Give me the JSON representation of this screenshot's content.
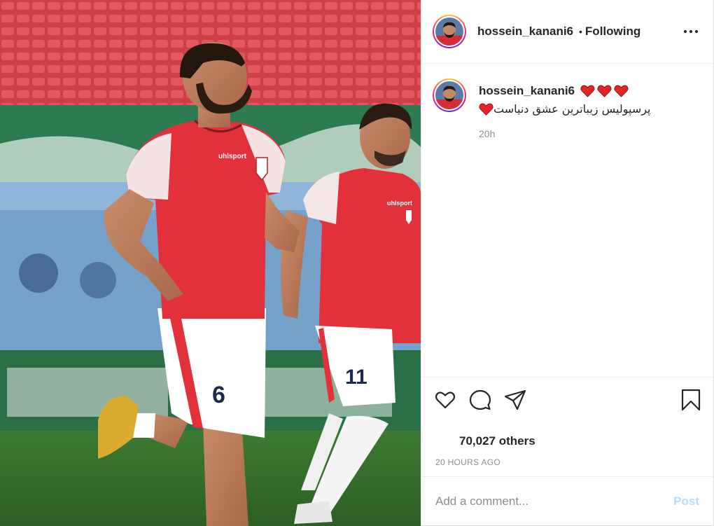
{
  "post": {
    "image": {
      "kit_brand": "uhlsport",
      "players": [
        {
          "shirt_number": "6"
        },
        {
          "shirt_number": "11"
        }
      ]
    },
    "header": {
      "username": "hossein_kanani6",
      "separator": "•",
      "follow_status": "Following"
    },
    "caption": {
      "username": "hossein_kanani6",
      "text": "پرسپولیس زیباترین عشق دنیاست",
      "emoji": "heart",
      "time": "20h"
    },
    "actions": {
      "like_icon": "heart-icon",
      "comment_icon": "comment-icon",
      "share_icon": "paper-plane-icon",
      "save_icon": "bookmark-icon"
    },
    "likes_text": "70,027 others",
    "post_time": "20 HOURS AGO",
    "comment": {
      "placeholder": "Add a comment...",
      "post_label": "Post"
    }
  },
  "colors": {
    "accent_blue_disabled": "#b2dffc",
    "muted_text": "#8e8e8e",
    "heart_red": "#ed4956",
    "kit_red": "#e2313b"
  }
}
